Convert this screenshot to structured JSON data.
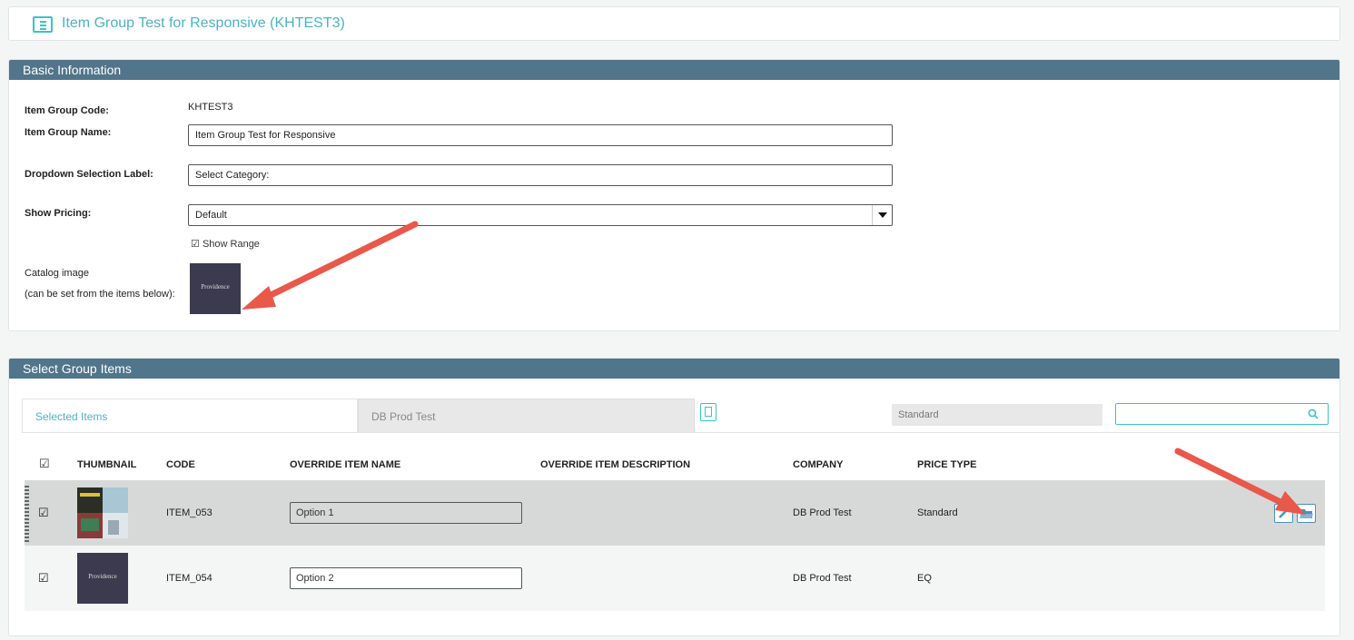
{
  "header": {
    "title": "Item Group Test for Responsive (KHTEST3)"
  },
  "basic_info": {
    "section_title": "Basic Information",
    "code_label": "Item Group Code:",
    "code_value": "KHTEST3",
    "name_label": "Item Group Name:",
    "name_value": "Item Group Test for Responsive",
    "dropdown_label": "Dropdown Selection Label:",
    "dropdown_value": "Select Category:",
    "pricing_label": "Show Pricing:",
    "pricing_value": "Default",
    "show_range_label": "Show Range",
    "catalog_label": "Catalog image",
    "catalog_note": "(can be set from the items below):",
    "catalog_thumb_text": "Providence"
  },
  "group_items": {
    "section_title": "Select Group Items",
    "tabs": [
      {
        "label": "Selected Items",
        "active": true
      },
      {
        "label": "DB Prod Test",
        "active": false
      }
    ],
    "price_type_filter": "Standard",
    "search_placeholder": "",
    "columns": [
      "THUMBNAIL",
      "CODE",
      "OVERRIDE ITEM NAME",
      "OVERRIDE ITEM DESCRIPTION",
      "COMPANY",
      "PRICE TYPE"
    ],
    "rows": [
      {
        "code": "ITEM_053",
        "override_name": "Option 1",
        "override_description": "",
        "company": "DB Prod Test",
        "price_type": "Standard",
        "thumb_text": ""
      },
      {
        "code": "ITEM_054",
        "override_name": "Option 2",
        "override_description": "",
        "company": "DB Prod Test",
        "price_type": "EQ",
        "thumb_text": "Providence"
      }
    ]
  },
  "colors": {
    "accent": "#3ec1c6",
    "panel_header": "#51758a",
    "annotation_arrow": "#e8584b"
  }
}
